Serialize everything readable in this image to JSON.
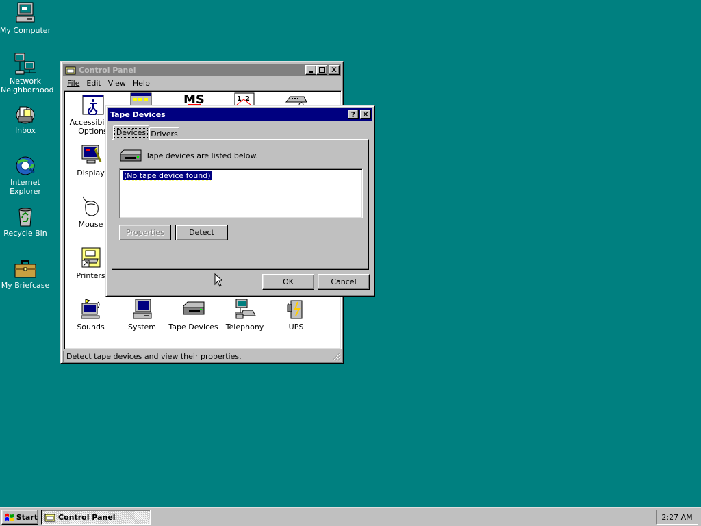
{
  "desktop": {
    "icons": [
      {
        "label": "My Computer"
      },
      {
        "label": "Network Neighborhood"
      },
      {
        "label": "Inbox"
      },
      {
        "label": "Internet Explorer"
      },
      {
        "label": "Recycle Bin"
      },
      {
        "label": "My Briefcase"
      }
    ]
  },
  "control_panel": {
    "title": "Control Panel",
    "menus": [
      "File",
      "Edit",
      "View",
      "Help"
    ],
    "icons": [
      {
        "label": "Accessibility Options"
      },
      {
        "label": "Display"
      },
      {
        "label": "Mouse"
      },
      {
        "label": "Printers"
      },
      {
        "label": "Sounds"
      },
      {
        "label": "System"
      },
      {
        "label": "Tape Devices"
      },
      {
        "label": "Telephony"
      },
      {
        "label": "UPS"
      }
    ],
    "status": "Detect tape devices and view their properties."
  },
  "dialog": {
    "title": "Tape Devices",
    "help_glyph": "?",
    "tabs": [
      "Devices",
      "Drivers"
    ],
    "heading": "Tape devices are listed below.",
    "list_items": [
      "(No tape device found)"
    ],
    "properties_label": "Properties",
    "detect_label": "Detect",
    "ok_label": "OK",
    "cancel_label": "Cancel"
  },
  "taskbar": {
    "start_label": "Start",
    "task_label": "Control Panel",
    "clock": "2:27 AM"
  },
  "colors": {
    "desktop": "#008080",
    "active_title": "#000080",
    "inactive_title": "#808080",
    "face": "#c0c0c0"
  }
}
